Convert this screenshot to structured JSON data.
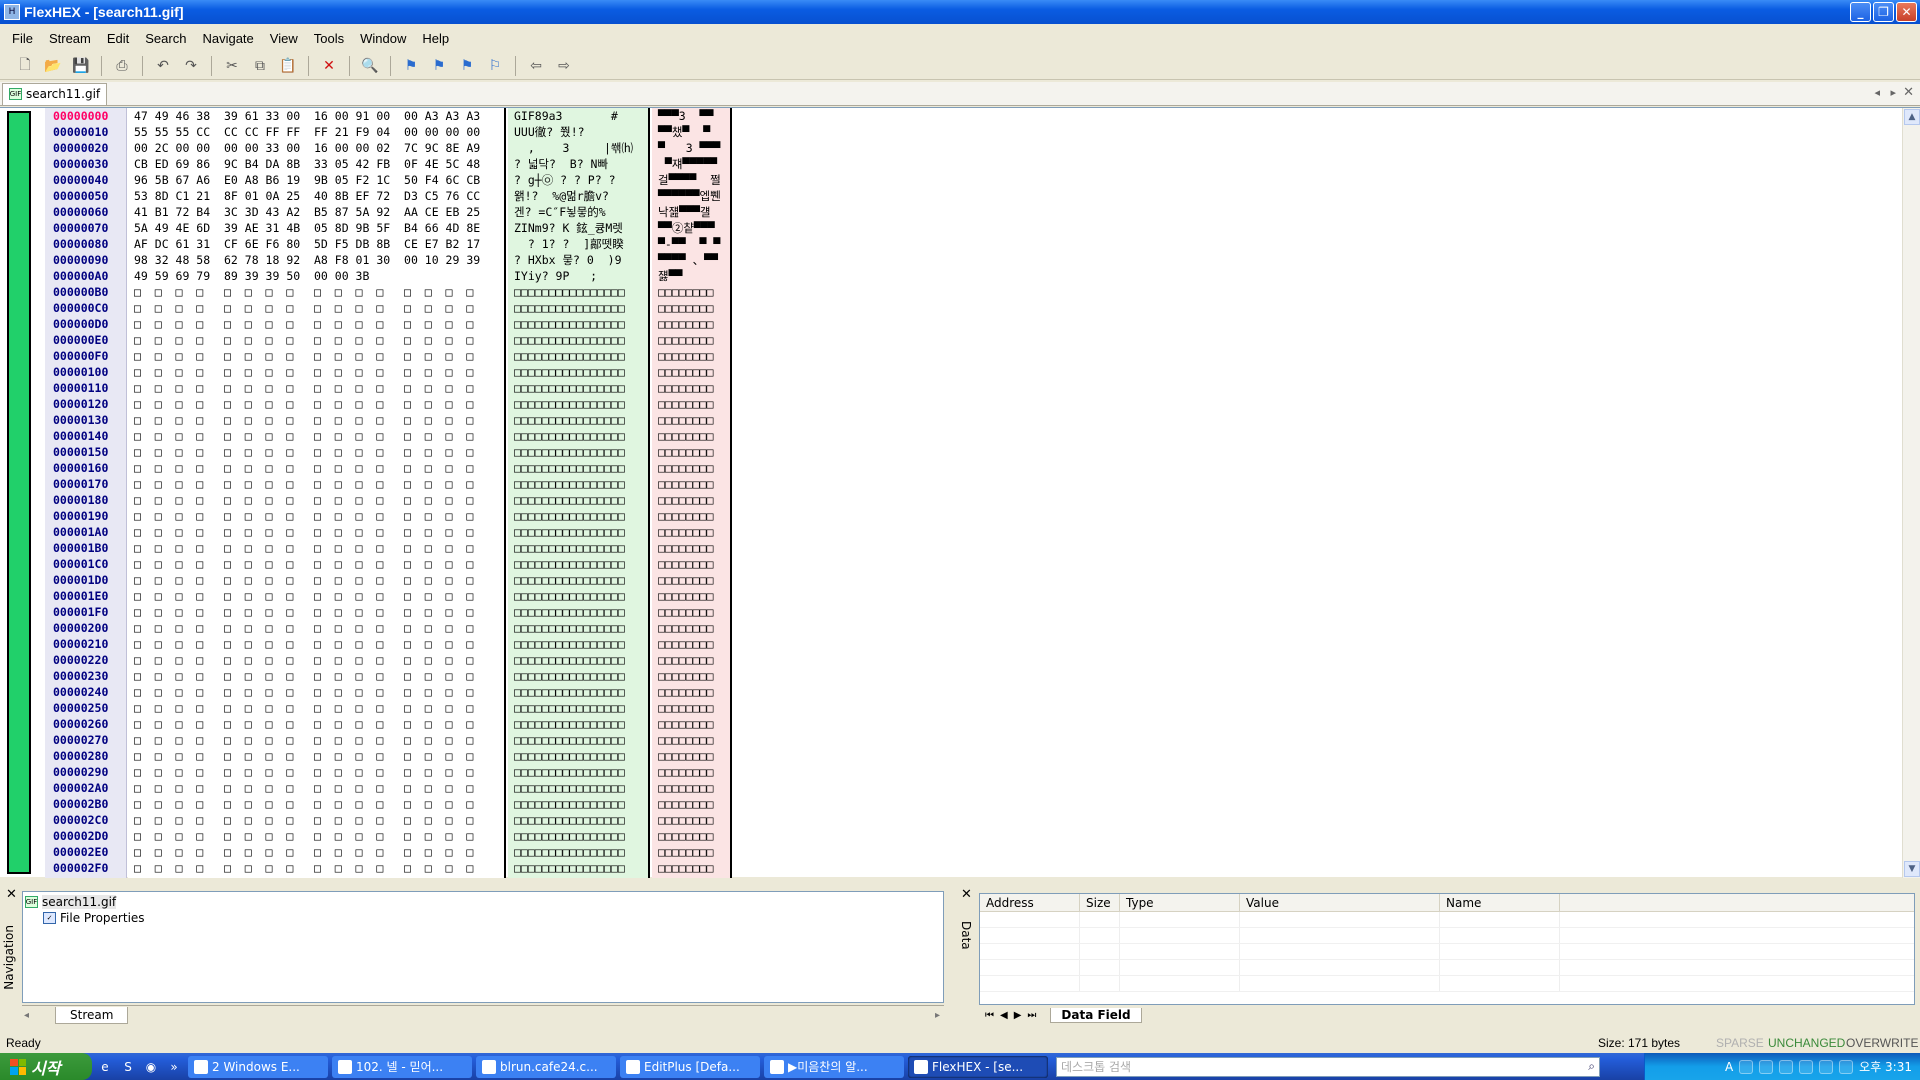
{
  "window": {
    "title": "FlexHEX - [search11.gif]",
    "min": "_",
    "max": "❐",
    "close": "✕"
  },
  "menu": [
    "File",
    "Stream",
    "Edit",
    "Search",
    "Navigate",
    "View",
    "Tools",
    "Window",
    "Help"
  ],
  "toolbar_icons": [
    "new-icon",
    "open-icon",
    "save-icon",
    "print-icon",
    "undo-icon",
    "redo-icon",
    "cut-icon",
    "copy-icon",
    "paste-icon",
    "delete-icon",
    "find-icon",
    "bookmark-icon",
    "bookmark-prev-icon",
    "bookmark-next-icon",
    "bookmark-clear-icon",
    "back-icon",
    "forward-icon"
  ],
  "doc_tab": {
    "label": "search11.gif",
    "icon_text": "GIF"
  },
  "hex": {
    "addresses": [
      "00000000",
      "00000010",
      "00000020",
      "00000030",
      "00000040",
      "00000050",
      "00000060",
      "00000070",
      "00000080",
      "00000090",
      "000000A0",
      "000000B0",
      "000000C0",
      "000000D0",
      "000000E0",
      "000000F0",
      "00000100",
      "00000110",
      "00000120",
      "00000130",
      "00000140",
      "00000150",
      "00000160",
      "00000170",
      "00000180",
      "00000190",
      "000001A0",
      "000001B0",
      "000001C0",
      "000001D0",
      "000001E0",
      "000001F0",
      "00000200",
      "00000210",
      "00000220",
      "00000230",
      "00000240",
      "00000250",
      "00000260",
      "00000270",
      "00000280",
      "00000290",
      "000002A0",
      "000002B0",
      "000002C0",
      "000002D0",
      "000002E0",
      "000002F0"
    ],
    "rows": [
      "47 49 46 38  39 61 33 00  16 00 91 00  00 A3 A3 A3",
      "55 55 55 CC  CC CC FF FF  FF 21 F9 04  00 00 00 00",
      "00 2C 00 00  00 00 33 00  16 00 00 02  7C 9C 8E A9",
      "CB ED 69 86  9C B4 DA 8B  33 05 42 FB  0F 4E 5C 48",
      "96 5B 67 A6  E0 A8 B6 19  9B 05 F2 1C  50 F4 6C CB",
      "53 8D C1 21  8F 01 0A 25  40 8B EF 72  D3 C5 76 CC",
      "41 B1 72 B4  3C 3D 43 A2  B5 87 5A 92  AA CE EB 25",
      "5A 49 4E 6D  39 AE 31 4B  05 8D 9B 5F  B4 66 4D 8E",
      "AF DC 61 31  CF 6E F6 80  5D F5 DB 8B  CE E7 B2 17",
      "98 32 48 58  62 78 18 92  A8 F8 01 30  00 10 29 39",
      "49 59 69 79  89 39 39 50  00 00 3B"
    ],
    "ascii": [
      "GIF89a3       #",
      "UUU徹? 쭸!?",
      "  ,    3     |쐒⒣",
      "? 넓닥?  B? N빠",
      "? g┼㉧ ? ? P? ?",
      "왥!?  %@멂r膽v?",
      "겐? =C″F뇧뭏的%",
      "ZINm9? K 鉉_큥M렛",
      "  ? 1? ?  ]鄗뗏睽",
      "? HXbx 뭏? 0  )9",
      "IYiy? 9P   ;"
    ],
    "unicode": [
      "▀▀▀3  ▀▀",
      "▀▀챘▀  ▀",
      "▀   3 ▀▀▀",
      " ▀쟤▀▀▀▀▀",
      "걸▀▀▀▀  쩔",
      "▀▀▀▀▀▀엡쀈",
      "낙쟲▀▀▀걜",
      "▀▀②챹▀▀▀",
      "▀-▀▀  ▀ ▀",
      "▀▀▀▀ 、▀▀",
      "쟳▀▀"
    ],
    "empty_hex": "□  □  □  □   □  □  □  □   □  □  □  □   □  □  □  □",
    "empty_ascii": "□□□□□□□□□□□□□□□□",
    "empty_unicode": "□□□□□□□□"
  },
  "navigation": {
    "label": "Navigation",
    "tree": [
      {
        "label": "search11.gif",
        "icon": "gif-file-icon"
      },
      {
        "label": "File Properties",
        "icon": "properties-icon"
      }
    ],
    "tab": "Stream"
  },
  "data": {
    "label": "Data",
    "columns": [
      "Address",
      "Size",
      "Type",
      "Value",
      "Name"
    ],
    "tab": "Data Field"
  },
  "status": {
    "ready": "Ready",
    "size": "Size: 171 bytes",
    "sparse": "SPARSE",
    "unchanged": "UNCHANGED",
    "overwrite": "OVERWRITE"
  },
  "taskbar": {
    "start": "시작",
    "buttons": [
      "2 Windows E...",
      "102. 넬 - 믿어...",
      "blrun.cafe24.c...",
      "EditPlus [Defa...",
      "▶미음찬의 알...",
      "FlexHEX - [se..."
    ],
    "search_placeholder": "데스크톱 검색",
    "clock": "오후 3:31",
    "lang": "A"
  }
}
